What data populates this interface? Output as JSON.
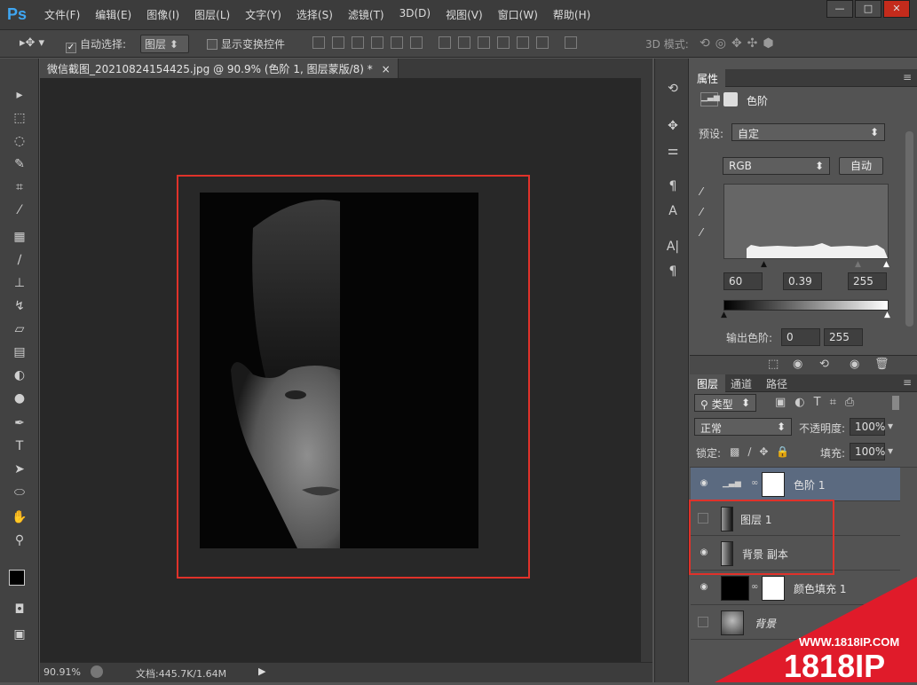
{
  "app": {
    "logo": "Ps"
  },
  "menu": [
    "文件(F)",
    "编辑(E)",
    "图像(I)",
    "图层(L)",
    "文字(Y)",
    "选择(S)",
    "滤镜(T)",
    "3D(D)",
    "视图(V)",
    "窗口(W)",
    "帮助(H)"
  ],
  "window_buttons": {
    "minimize": "—",
    "maximize": "□",
    "close": "✕"
  },
  "options": {
    "auto_select_label": "自动选择:",
    "auto_select_value": "图层",
    "show_transform_label": "显示变换控件",
    "mode_3d_label": "3D 模式:"
  },
  "document": {
    "tab_title": "微信截图_20210824154425.jpg @ 90.9% (色阶 1, 图层蒙版/8) *",
    "tab_close": "×"
  },
  "status": {
    "zoom": "90.91%",
    "doc_info": "文档:445.7K/1.64M"
  },
  "properties": {
    "tab": "属性",
    "title": "色阶",
    "preset_label": "预设:",
    "preset_value": "自定",
    "channel_value": "RGB",
    "auto_button": "自动",
    "input_black": "60",
    "input_gamma": "0.39",
    "input_white": "255",
    "output_label": "输出色阶:",
    "output_black": "0",
    "output_white": "255"
  },
  "layers_panel": {
    "tabs": [
      "图层",
      "通道",
      "路径"
    ],
    "filter_kind": "类型",
    "blend_mode": "正常",
    "opacity_label": "不透明度:",
    "opacity_value": "100%",
    "lock_label": "锁定:",
    "fill_label": "填充:",
    "fill_value": "100%",
    "layers": [
      {
        "name": "色阶 1",
        "visible": true,
        "selected": true
      },
      {
        "name": "图层 1",
        "visible": false,
        "selected": false
      },
      {
        "name": "背景 副本",
        "visible": true,
        "selected": false
      },
      {
        "name": "颜色填充 1",
        "visible": true,
        "selected": false
      },
      {
        "name": "背景",
        "visible": false,
        "selected": false
      }
    ]
  },
  "watermark": {
    "url": "WWW.1818IP.COM",
    "brand": "1818IP"
  },
  "colors": {
    "accent_red": "#e0322a",
    "selected_layer": "#5b6a80",
    "ps_blue": "#3fa6f2"
  }
}
